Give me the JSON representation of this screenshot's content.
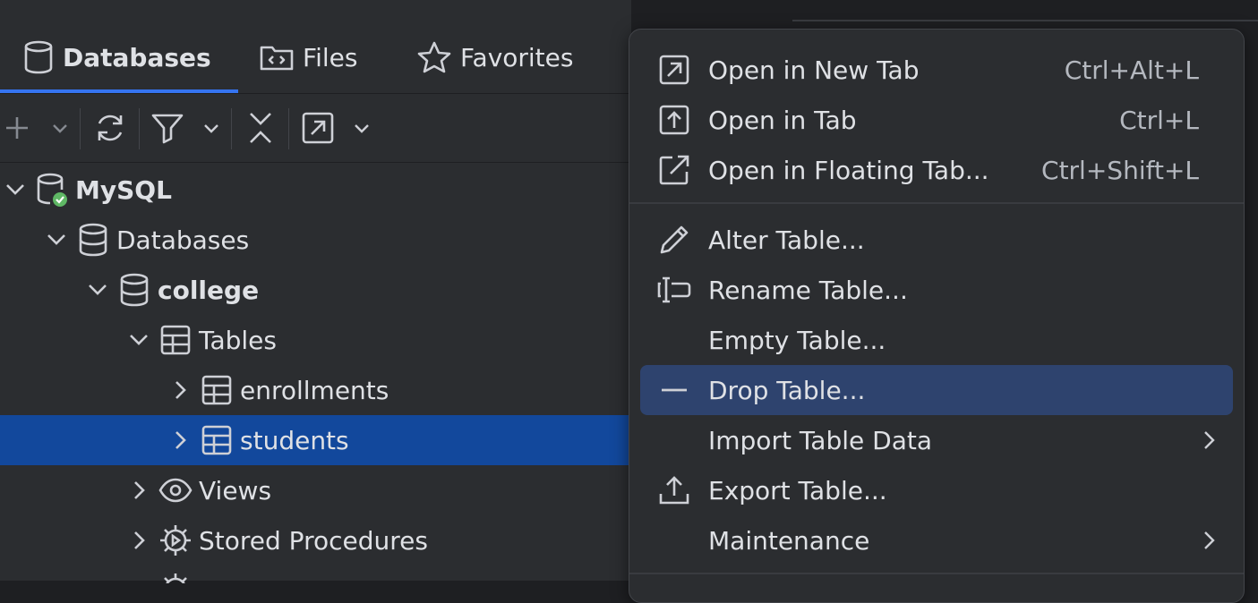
{
  "tabs": {
    "databases": "Databases",
    "files": "Files",
    "favorites": "Favorites"
  },
  "tree": {
    "mysql": "MySQL",
    "databases": "Databases",
    "college": "college",
    "tables": "Tables",
    "enrollments": "enrollments",
    "students": "students",
    "views": "Views",
    "stored_procedures": "Stored Procedures"
  },
  "menu": {
    "open_new_tab": {
      "label": "Open in New Tab",
      "shortcut": "Ctrl+Alt+L"
    },
    "open_tab": {
      "label": "Open in Tab",
      "shortcut": "Ctrl+L"
    },
    "open_floating": {
      "label": "Open in Floating Tab...",
      "shortcut": "Ctrl+Shift+L"
    },
    "alter_table": {
      "label": "Alter Table..."
    },
    "rename_table": {
      "label": "Rename Table..."
    },
    "empty_table": {
      "label": "Empty Table..."
    },
    "drop_table": {
      "label": "Drop Table..."
    },
    "import_data": {
      "label": "Import Table Data"
    },
    "export_table": {
      "label": "Export Table..."
    },
    "maintenance": {
      "label": "Maintenance"
    }
  },
  "colors": {
    "accent": "#3574f0",
    "selection": "#12489c",
    "menu_highlight": "#2e436e",
    "success": "#5fb865"
  }
}
